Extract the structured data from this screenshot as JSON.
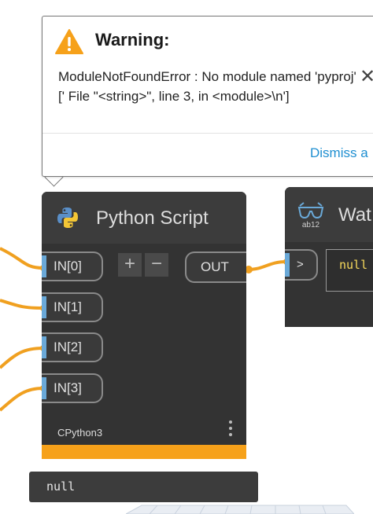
{
  "warning": {
    "title": "Warning:",
    "message": "ModuleNotFoundError : No module named 'pyproj' ['  File \"<string>\", line 3, in <module>\\n']",
    "close_glyph": "✕",
    "dismiss_label": "Dismiss a",
    "icon": "warning-triangle-icon",
    "accent": "#f6a11a"
  },
  "python_node": {
    "title": "Python Script",
    "icon": "python-logo-icon",
    "inputs": [
      "IN[0]",
      "IN[1]",
      "IN[2]",
      "IN[3]"
    ],
    "add_label": "+",
    "remove_label": "−",
    "output": "OUT",
    "engine": "CPython3",
    "menu_icon": "kebab-menu-icon",
    "status_color": "#f6a11a",
    "preview": "null"
  },
  "watch_node": {
    "title": "Wat",
    "icon": "watch-glasses-icon",
    "icon_text": "ab12",
    "input_port": ">",
    "value": "null"
  },
  "colors": {
    "wire": "#f0a020",
    "port_marker": "#6aa9d8",
    "link": "#1f8fd1"
  }
}
